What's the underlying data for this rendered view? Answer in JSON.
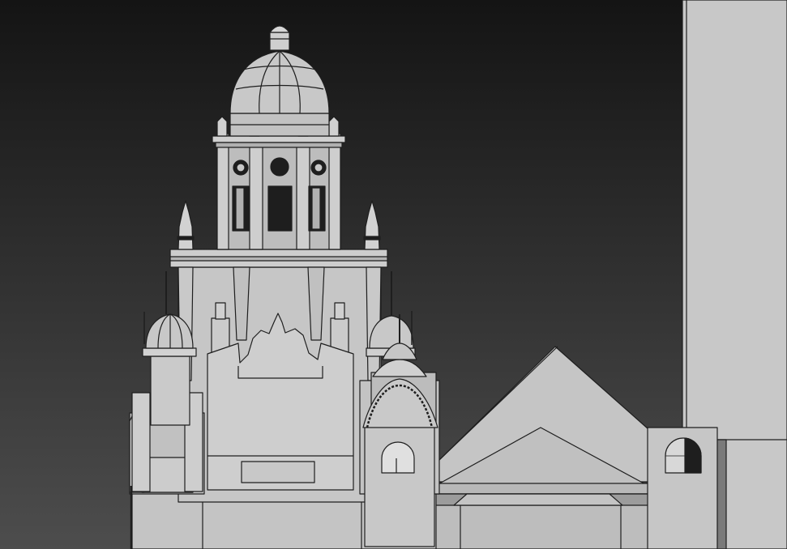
{
  "viewport": {
    "background_top": "#141414",
    "background_bottom": "#4d4d4d",
    "model_fill": "#c3c3c3",
    "model_fill_light": "#d2d2d2",
    "model_fill_dark": "#9a9a9a",
    "edge_color": "#1e1e1e"
  }
}
